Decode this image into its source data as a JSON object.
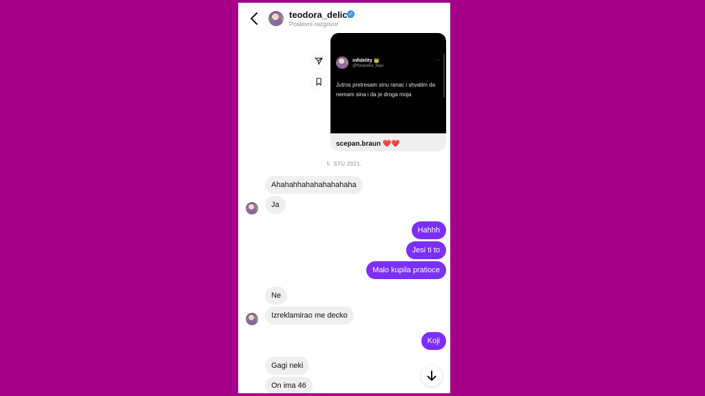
{
  "header": {
    "username": "teodora_delicc",
    "verified_glyph": "✓",
    "subtitle": "Poslovni razgovor",
    "back_icon": "chevron-left-icon"
  },
  "shared_post": {
    "tweet_name": "infidelity 👑",
    "tweet_handle": "@Naopaka_baja",
    "tweet_menu": "···",
    "tweet_text": "Jutros pretresam sinu ranac i shvatim da nemam sina i da je droga moja",
    "caption_user": "scepan.braun",
    "caption_emoji": "❤️❤️"
  },
  "date_separator": "5. STU 2021.",
  "messages": [
    {
      "text": "Ahahahhahahahahahaha"
    },
    {
      "text": "Ja"
    },
    {
      "text": "Hahhh"
    },
    {
      "text": "Jesi ti to"
    },
    {
      "text": "Malo kupila pratioce"
    },
    {
      "text": "Ne"
    },
    {
      "text": "Izreklamirao me decko"
    },
    {
      "text": "Koji"
    },
    {
      "text": "Gagi neki"
    },
    {
      "text": "On ima 46"
    }
  ],
  "colors": {
    "background": "#a6008a",
    "outgoing_bubble": "#7b2ff7",
    "incoming_bubble": "#efefef",
    "verified": "#3897f0"
  }
}
